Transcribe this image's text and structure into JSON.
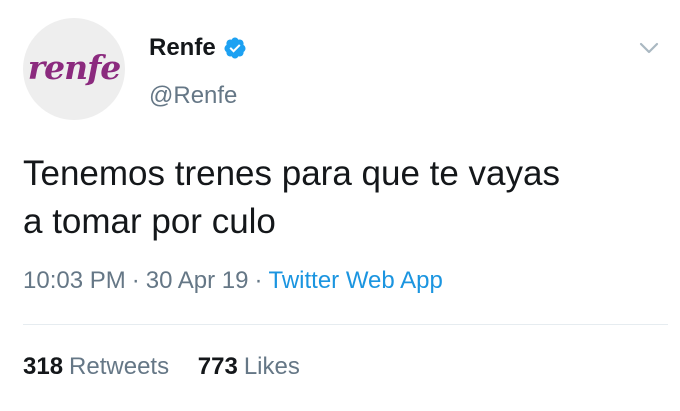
{
  "author": {
    "avatar_logo_text": "renfe",
    "display_name": "Renfe",
    "handle": "@Renfe",
    "verified": true,
    "verified_icon": "verified-badge-icon"
  },
  "menu": {
    "icon": "chevron-down-icon"
  },
  "tweet": {
    "text_line1": "Tenemos trenes para que te vayas",
    "text_line2": "a tomar por culo",
    "time": "10:03 PM",
    "date": "30 Apr 19",
    "separator": "·",
    "source": "Twitter Web App"
  },
  "stats": {
    "retweets_count": "318",
    "retweets_label": "Retweets",
    "likes_count": "773",
    "likes_label": "Likes"
  },
  "colors": {
    "brand_purple": "#8b2a7e",
    "link_blue": "#1b95e0",
    "verified_blue": "#1da1f2",
    "secondary_text": "#657786",
    "primary_text": "#14171a"
  }
}
